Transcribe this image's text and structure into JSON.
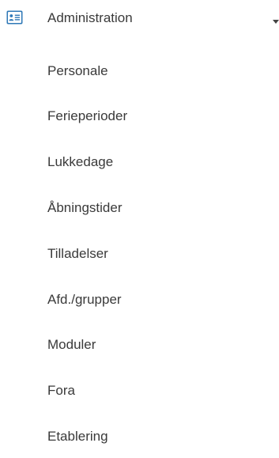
{
  "nav": {
    "section": {
      "icon": "id-card-icon",
      "title": "Administration",
      "expanded": true,
      "accent_color": "#2f78b7"
    },
    "items": [
      {
        "label": "Personale"
      },
      {
        "label": "Ferieperioder"
      },
      {
        "label": "Lukkedage"
      },
      {
        "label": "Åbningstider"
      },
      {
        "label": "Tilladelser"
      },
      {
        "label": "Afd./grupper"
      },
      {
        "label": "Moduler"
      },
      {
        "label": "Fora"
      },
      {
        "label": "Etablering"
      }
    ]
  }
}
